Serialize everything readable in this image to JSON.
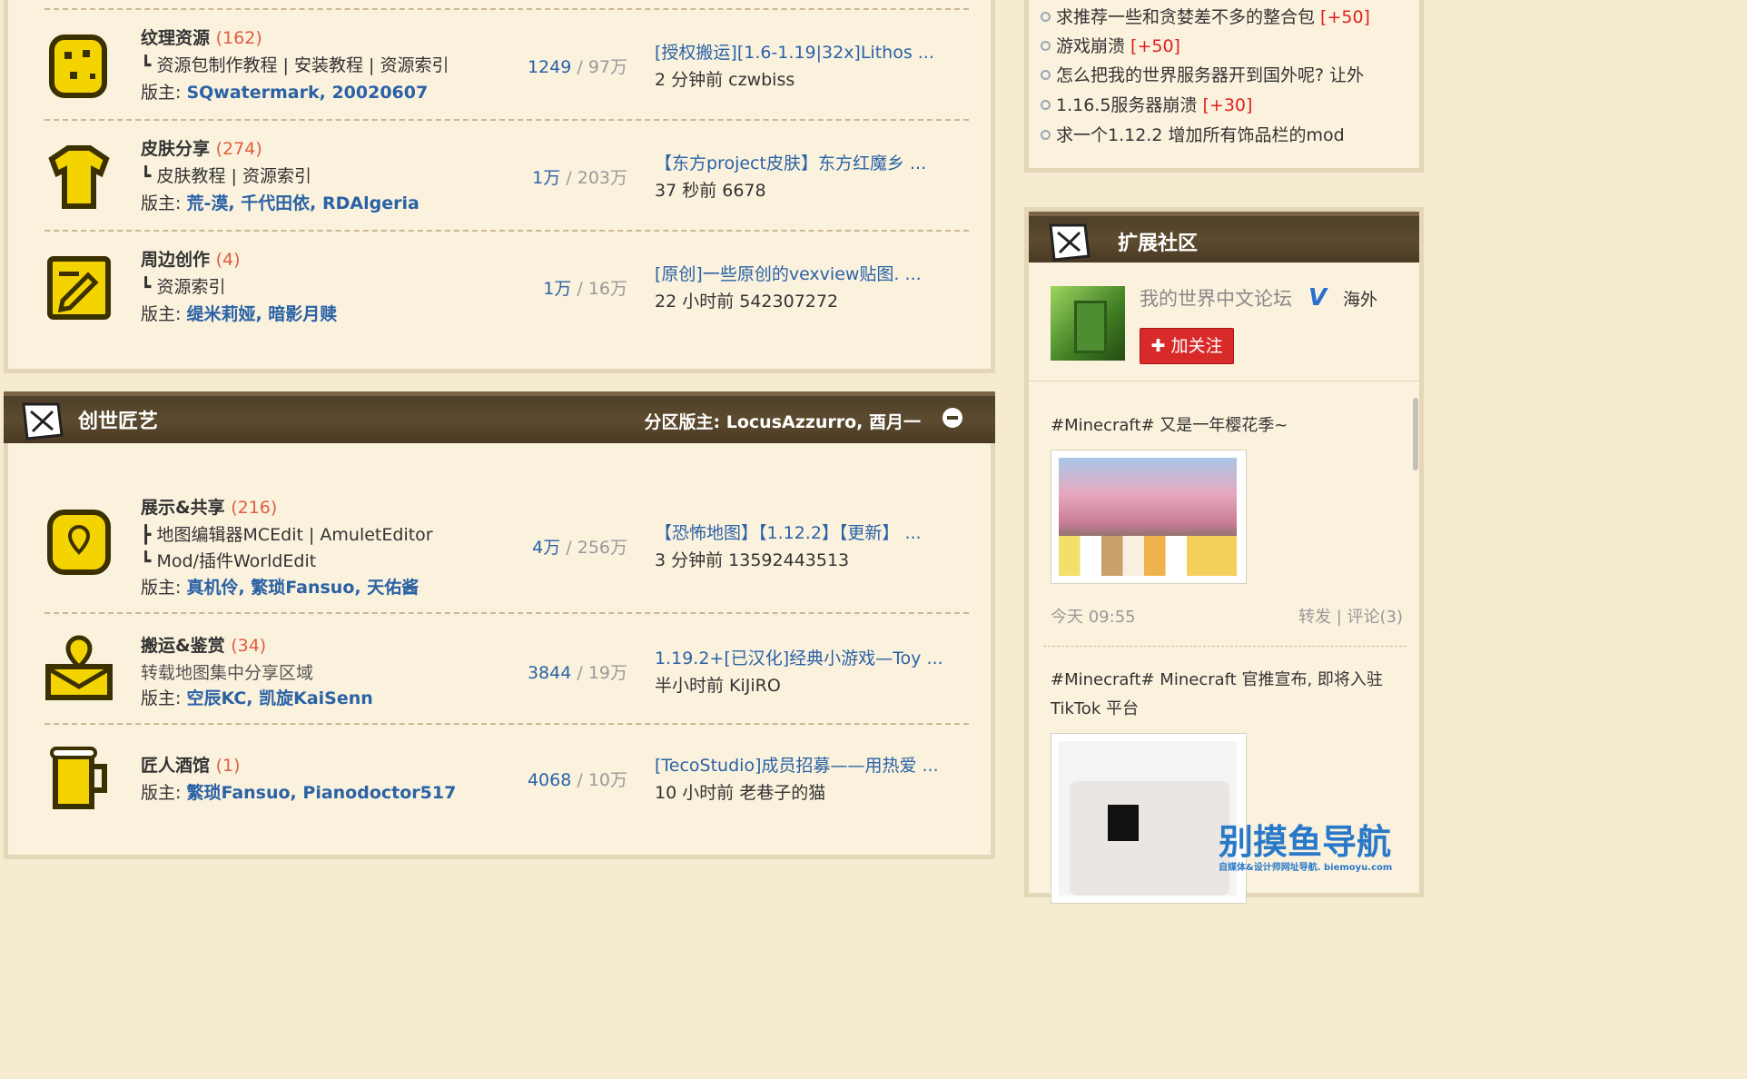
{
  "forums": [
    {
      "name": "纹理资源",
      "count": "(162)",
      "subs": [
        "┗ 资源包制作教程 | 安装教程 | 资源索引"
      ],
      "mods_label": "版主: ",
      "mods": "SQwatermark, 20020607",
      "threads": "1249",
      "posts": "97万",
      "last_title": "[授权搬运][1.6-1.19|32x]Lithos ...",
      "last_meta": "2 分钟前 czwbiss"
    },
    {
      "name": "皮肤分享",
      "count": "(274)",
      "subs": [
        "┗ 皮肤教程 | 资源索引"
      ],
      "mods_label": "版主: ",
      "mods": "荒-漠, 千代田依, RDAlgeria",
      "threads": "1万",
      "posts": "203万",
      "last_title": "【东方project皮肤】东方红魔乡 ...",
      "last_meta": "37 秒前 6678"
    },
    {
      "name": "周边创作",
      "count": "(4)",
      "subs": [
        "┗ 资源索引"
      ],
      "mods_label": "版主: ",
      "mods": "缇米莉娅, 暗影月赎",
      "threads": "1万",
      "posts": "16万",
      "last_title": "[原创]一些原创的vexview贴图. ...",
      "last_meta": "22 小时前 542307272"
    }
  ],
  "section": {
    "title": "创世匠艺",
    "moderator": "分区版主: LocusAzzurro, 酉月一"
  },
  "forums2": [
    {
      "name": "展示&共享",
      "count": "(216)",
      "subs": [
        "┣ 地图编辑器MCEdit | AmuletEditor",
        "┗ Mod/插件WorldEdit"
      ],
      "mods_label": "版主: ",
      "mods": "真机伶, 繁琐Fansuo, 天佑酱",
      "threads": "4万",
      "posts": "256万",
      "last_title": "【恐怖地图】【1.12.2】【更新】 ...",
      "last_meta": "3 分钟前 13592443513"
    },
    {
      "name": "搬运&鉴赏",
      "count": "(34)",
      "subs": [
        "转载地图集中分享区域"
      ],
      "mods_label": "版主: ",
      "mods": "空辰KC, 凯旋KaiSenn",
      "threads": "3844",
      "posts": "19万",
      "last_title": "1.19.2+[已汉化]经典小游戏—Toy ...",
      "last_meta": "半小时前 KiJiRO"
    },
    {
      "name": "匠人酒馆",
      "count": "(1)",
      "subs": [],
      "mods_label": "版主: ",
      "mods": "繁琐Fansuo, Pianodoctor517",
      "threads": "4068",
      "posts": "10万",
      "last_title": "[TecoStudio]成员招募——用热爱 ...",
      "last_meta": "10 小时前 老巷子的猫"
    }
  ],
  "hot": [
    {
      "text": "求推荐一些和贪婪差不多的整合包 ",
      "plus": "[+50]"
    },
    {
      "text": "游戏崩溃 ",
      "plus": "[+50]"
    },
    {
      "text": "怎么把我的世界服务器开到国外呢? 让外",
      "plus": ""
    },
    {
      "text": "1.16.5服务器崩溃 ",
      "plus": "[+30]"
    },
    {
      "text": "求一个1.12.2 增加所有饰品栏的mod",
      "plus": ""
    }
  ],
  "ext": {
    "title": "扩展社区",
    "weibo_name": "我的世界中文论坛",
    "v": "V",
    "region": "海外",
    "follow": "✚ 加关注",
    "post1": "#Minecraft# 又是一年樱花季~",
    "post1_time": "今天 09:55",
    "post1_actions": "转发  |  评论(3)",
    "post2": "#Minecraft# Minecraft 官推宣布, 即将入驻 TikTok 平台"
  },
  "watermark": {
    "title": "别摸鱼导航",
    "sub": "自媒体&设计师网址导航. biemoyu.com"
  },
  "colors": {
    "accent": "#2a62a5",
    "count": "#e05d3f",
    "header": "#4e3f28",
    "plus": "#e02020"
  }
}
